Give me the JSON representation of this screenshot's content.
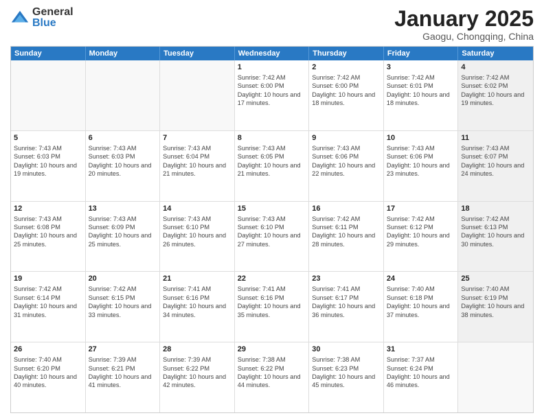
{
  "logo": {
    "general": "General",
    "blue": "Blue"
  },
  "header": {
    "month": "January 2025",
    "location": "Gaogu, Chongqing, China"
  },
  "weekdays": [
    "Sunday",
    "Monday",
    "Tuesday",
    "Wednesday",
    "Thursday",
    "Friday",
    "Saturday"
  ],
  "rows": [
    [
      {
        "day": "",
        "info": "",
        "shaded": false,
        "empty": true
      },
      {
        "day": "",
        "info": "",
        "shaded": false,
        "empty": true
      },
      {
        "day": "",
        "info": "",
        "shaded": false,
        "empty": true
      },
      {
        "day": "1",
        "info": "Sunrise: 7:42 AM\nSunset: 6:00 PM\nDaylight: 10 hours and 17 minutes.",
        "shaded": false,
        "empty": false
      },
      {
        "day": "2",
        "info": "Sunrise: 7:42 AM\nSunset: 6:00 PM\nDaylight: 10 hours and 18 minutes.",
        "shaded": false,
        "empty": false
      },
      {
        "day": "3",
        "info": "Sunrise: 7:42 AM\nSunset: 6:01 PM\nDaylight: 10 hours and 18 minutes.",
        "shaded": false,
        "empty": false
      },
      {
        "day": "4",
        "info": "Sunrise: 7:42 AM\nSunset: 6:02 PM\nDaylight: 10 hours and 19 minutes.",
        "shaded": true,
        "empty": false
      }
    ],
    [
      {
        "day": "5",
        "info": "Sunrise: 7:43 AM\nSunset: 6:03 PM\nDaylight: 10 hours and 19 minutes.",
        "shaded": false,
        "empty": false
      },
      {
        "day": "6",
        "info": "Sunrise: 7:43 AM\nSunset: 6:03 PM\nDaylight: 10 hours and 20 minutes.",
        "shaded": false,
        "empty": false
      },
      {
        "day": "7",
        "info": "Sunrise: 7:43 AM\nSunset: 6:04 PM\nDaylight: 10 hours and 21 minutes.",
        "shaded": false,
        "empty": false
      },
      {
        "day": "8",
        "info": "Sunrise: 7:43 AM\nSunset: 6:05 PM\nDaylight: 10 hours and 21 minutes.",
        "shaded": false,
        "empty": false
      },
      {
        "day": "9",
        "info": "Sunrise: 7:43 AM\nSunset: 6:06 PM\nDaylight: 10 hours and 22 minutes.",
        "shaded": false,
        "empty": false
      },
      {
        "day": "10",
        "info": "Sunrise: 7:43 AM\nSunset: 6:06 PM\nDaylight: 10 hours and 23 minutes.",
        "shaded": false,
        "empty": false
      },
      {
        "day": "11",
        "info": "Sunrise: 7:43 AM\nSunset: 6:07 PM\nDaylight: 10 hours and 24 minutes.",
        "shaded": true,
        "empty": false
      }
    ],
    [
      {
        "day": "12",
        "info": "Sunrise: 7:43 AM\nSunset: 6:08 PM\nDaylight: 10 hours and 25 minutes.",
        "shaded": false,
        "empty": false
      },
      {
        "day": "13",
        "info": "Sunrise: 7:43 AM\nSunset: 6:09 PM\nDaylight: 10 hours and 25 minutes.",
        "shaded": false,
        "empty": false
      },
      {
        "day": "14",
        "info": "Sunrise: 7:43 AM\nSunset: 6:10 PM\nDaylight: 10 hours and 26 minutes.",
        "shaded": false,
        "empty": false
      },
      {
        "day": "15",
        "info": "Sunrise: 7:43 AM\nSunset: 6:10 PM\nDaylight: 10 hours and 27 minutes.",
        "shaded": false,
        "empty": false
      },
      {
        "day": "16",
        "info": "Sunrise: 7:42 AM\nSunset: 6:11 PM\nDaylight: 10 hours and 28 minutes.",
        "shaded": false,
        "empty": false
      },
      {
        "day": "17",
        "info": "Sunrise: 7:42 AM\nSunset: 6:12 PM\nDaylight: 10 hours and 29 minutes.",
        "shaded": false,
        "empty": false
      },
      {
        "day": "18",
        "info": "Sunrise: 7:42 AM\nSunset: 6:13 PM\nDaylight: 10 hours and 30 minutes.",
        "shaded": true,
        "empty": false
      }
    ],
    [
      {
        "day": "19",
        "info": "Sunrise: 7:42 AM\nSunset: 6:14 PM\nDaylight: 10 hours and 31 minutes.",
        "shaded": false,
        "empty": false
      },
      {
        "day": "20",
        "info": "Sunrise: 7:42 AM\nSunset: 6:15 PM\nDaylight: 10 hours and 33 minutes.",
        "shaded": false,
        "empty": false
      },
      {
        "day": "21",
        "info": "Sunrise: 7:41 AM\nSunset: 6:16 PM\nDaylight: 10 hours and 34 minutes.",
        "shaded": false,
        "empty": false
      },
      {
        "day": "22",
        "info": "Sunrise: 7:41 AM\nSunset: 6:16 PM\nDaylight: 10 hours and 35 minutes.",
        "shaded": false,
        "empty": false
      },
      {
        "day": "23",
        "info": "Sunrise: 7:41 AM\nSunset: 6:17 PM\nDaylight: 10 hours and 36 minutes.",
        "shaded": false,
        "empty": false
      },
      {
        "day": "24",
        "info": "Sunrise: 7:40 AM\nSunset: 6:18 PM\nDaylight: 10 hours and 37 minutes.",
        "shaded": false,
        "empty": false
      },
      {
        "day": "25",
        "info": "Sunrise: 7:40 AM\nSunset: 6:19 PM\nDaylight: 10 hours and 38 minutes.",
        "shaded": true,
        "empty": false
      }
    ],
    [
      {
        "day": "26",
        "info": "Sunrise: 7:40 AM\nSunset: 6:20 PM\nDaylight: 10 hours and 40 minutes.",
        "shaded": false,
        "empty": false
      },
      {
        "day": "27",
        "info": "Sunrise: 7:39 AM\nSunset: 6:21 PM\nDaylight: 10 hours and 41 minutes.",
        "shaded": false,
        "empty": false
      },
      {
        "day": "28",
        "info": "Sunrise: 7:39 AM\nSunset: 6:22 PM\nDaylight: 10 hours and 42 minutes.",
        "shaded": false,
        "empty": false
      },
      {
        "day": "29",
        "info": "Sunrise: 7:38 AM\nSunset: 6:22 PM\nDaylight: 10 hours and 44 minutes.",
        "shaded": false,
        "empty": false
      },
      {
        "day": "30",
        "info": "Sunrise: 7:38 AM\nSunset: 6:23 PM\nDaylight: 10 hours and 45 minutes.",
        "shaded": false,
        "empty": false
      },
      {
        "day": "31",
        "info": "Sunrise: 7:37 AM\nSunset: 6:24 PM\nDaylight: 10 hours and 46 minutes.",
        "shaded": false,
        "empty": false
      },
      {
        "day": "",
        "info": "",
        "shaded": true,
        "empty": true
      }
    ]
  ]
}
